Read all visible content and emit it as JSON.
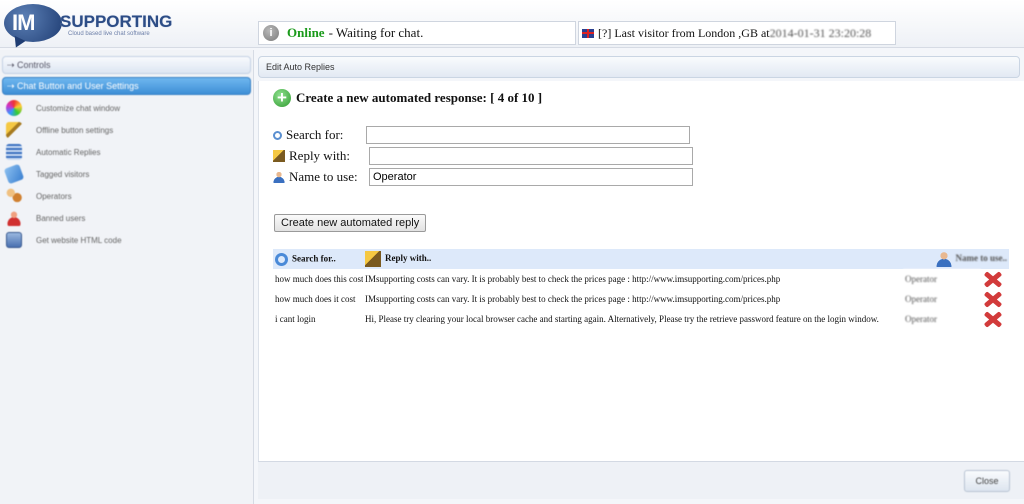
{
  "header": {
    "logo_im": "IM",
    "logo_text": "SUPPORTING",
    "logo_tagline": "Cloud based live chat software",
    "status_label": "Online",
    "status_text": " - Waiting for chat.",
    "visitor_text": "[?] Last visitor from London ,GB at ",
    "visitor_time": "2014-01-31 23:20:28"
  },
  "sidebar": {
    "sections": [
      {
        "label": "Controls",
        "active": false
      },
      {
        "label": "Chat Button and User Settings",
        "active": true
      }
    ],
    "items": [
      {
        "label": "Customize chat window",
        "icon": "color-wheel-icon",
        "color": "#c060c8"
      },
      {
        "label": "Offline button settings",
        "icon": "wand-icon",
        "color": "#e8b030"
      },
      {
        "label": "Automatic Replies",
        "icon": "document-icon",
        "color": "#3a70c0"
      },
      {
        "label": "Tagged visitors",
        "icon": "tag-icon",
        "color": "#4a90d8"
      },
      {
        "label": "Operators",
        "icon": "operators-icon",
        "color": "#d09030"
      },
      {
        "label": "Banned users",
        "icon": "banned-icon",
        "color": "#d04040"
      },
      {
        "label": "Get website HTML code",
        "icon": "code-icon",
        "color": "#5a80c0"
      }
    ]
  },
  "main": {
    "tab_label": "Edit Auto Replies",
    "form_title": "Create a new automated response: [ 4 of 10 ]",
    "search_label": "Search for:",
    "search_value": "",
    "reply_label": "Reply with:",
    "reply_value": "",
    "name_label": "Name to use:",
    "name_value": "Operator",
    "create_button": "Create new automated reply",
    "table": {
      "headers": [
        "Search for..",
        "Reply with..",
        "Name to use.."
      ],
      "rows": [
        {
          "search": "how much does this cost",
          "reply": "IMsupporting costs can vary. It is probably best to check the prices page : http://www.imsupporting.com/prices.php",
          "name": "Operator"
        },
        {
          "search": "how much does it cost",
          "reply": "IMsupporting costs can vary. It is probably best to check the prices page : http://www.imsupporting.com/prices.php",
          "name": "Operator"
        },
        {
          "search": "i cant login",
          "reply": "Hi, Please try clearing your local browser cache and starting again. Alternatively, Please try the retrieve password feature on the login window.",
          "name": "Operator"
        }
      ]
    },
    "close_button": "Close"
  }
}
